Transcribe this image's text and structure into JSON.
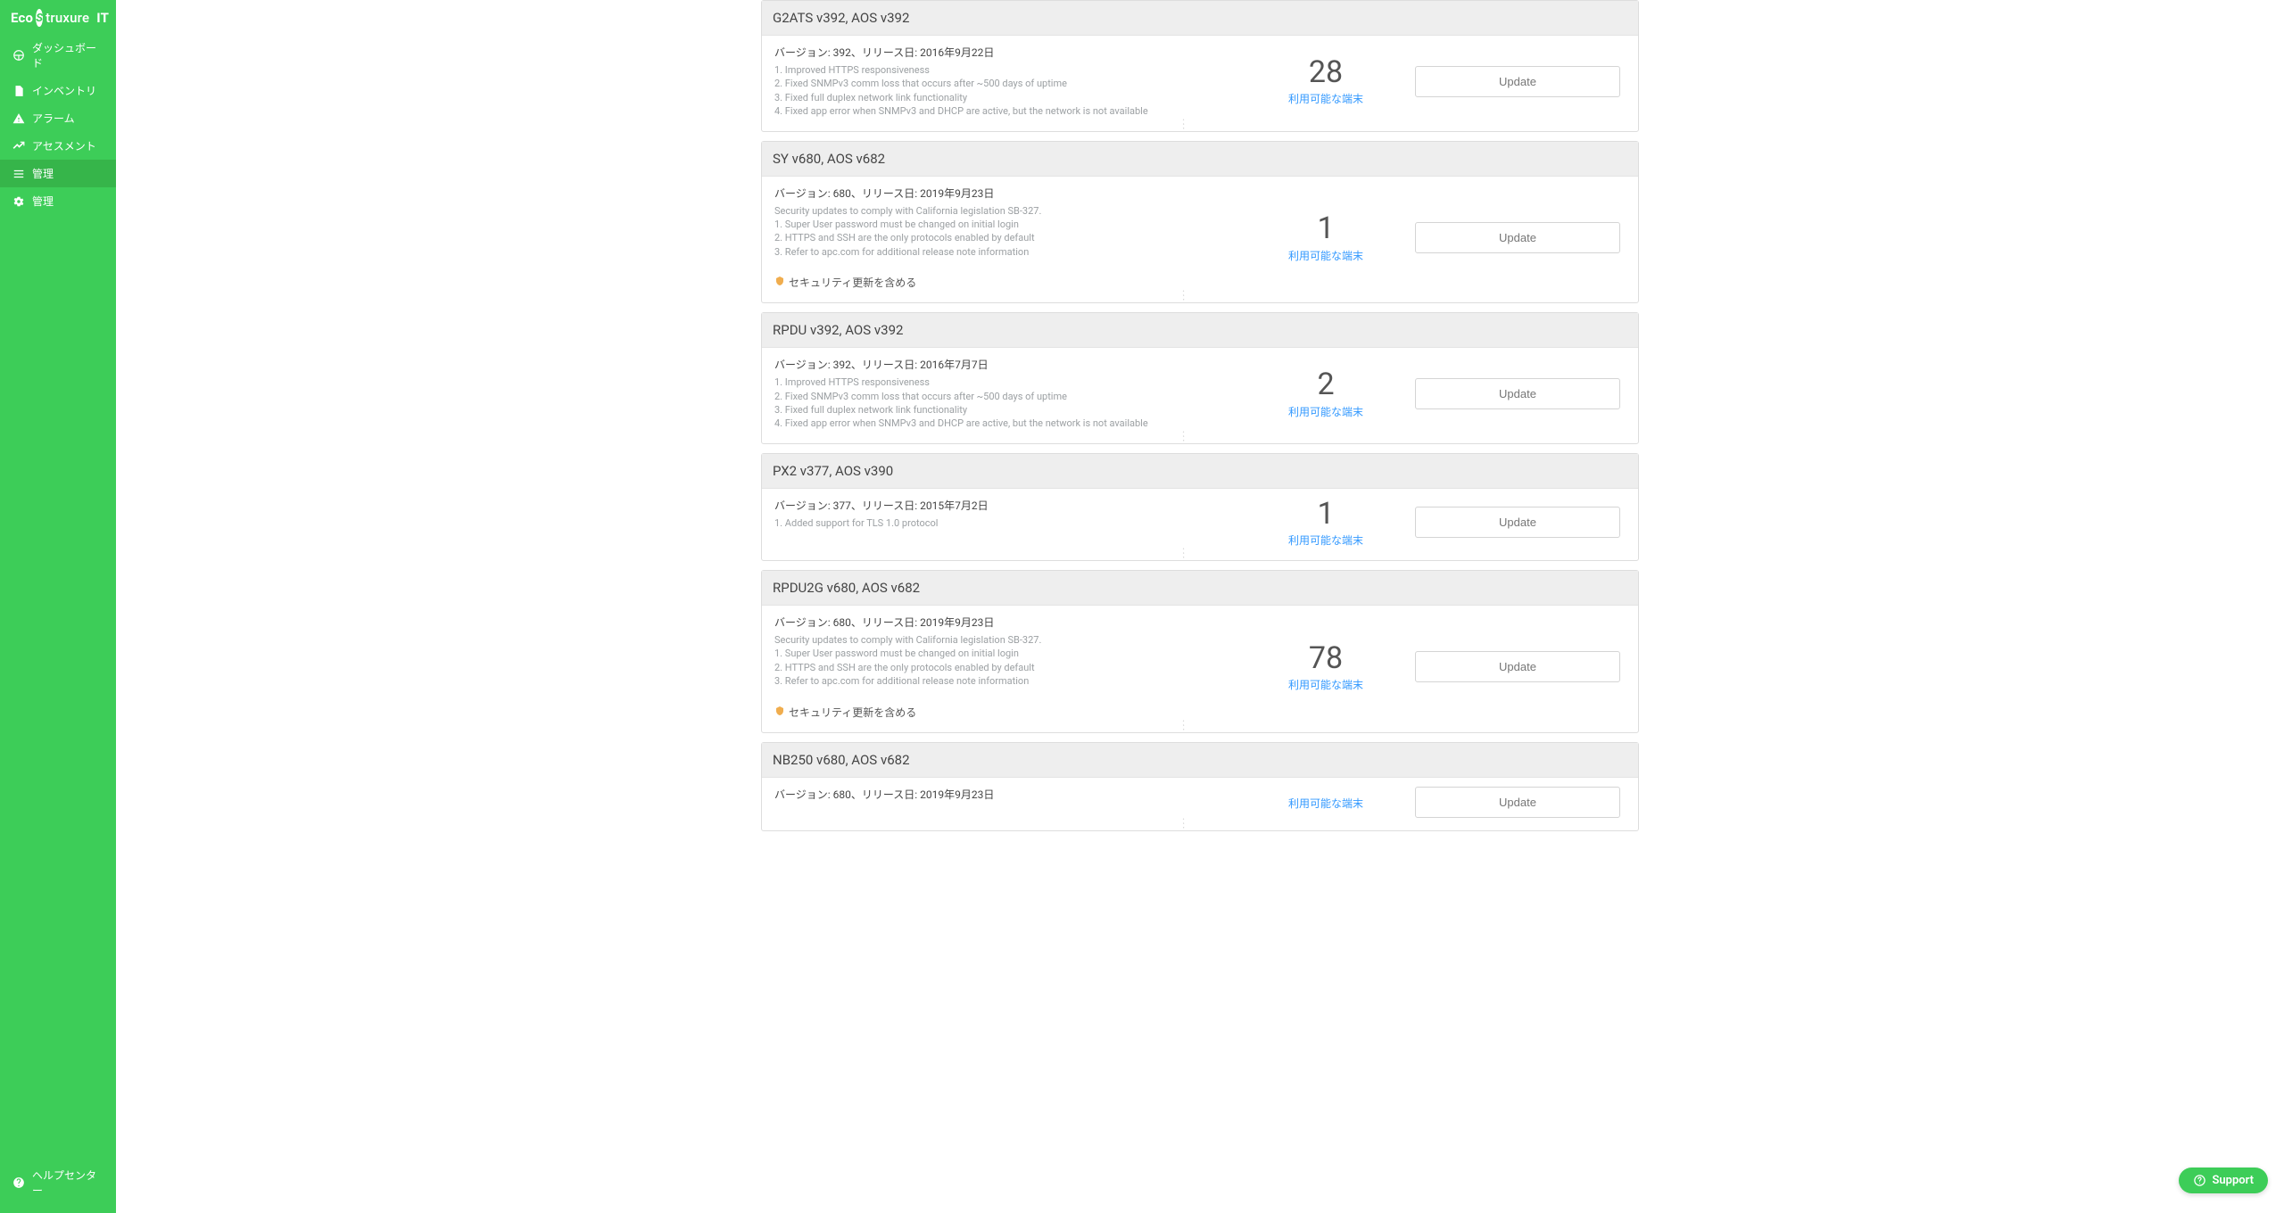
{
  "brand": {
    "part1": "Eco",
    "part2": "truxure",
    "part3": "IT"
  },
  "sidebar": {
    "items": [
      {
        "label": "ダッシュボード"
      },
      {
        "label": "インベントリ"
      },
      {
        "label": "アラーム"
      },
      {
        "label": "アセスメント"
      },
      {
        "label": "管理"
      },
      {
        "label": "管理"
      }
    ],
    "help_label": "ヘルプセンター"
  },
  "common": {
    "available_label": "利用可能な端末",
    "update_label": "Update",
    "security_label": "セキュリティ更新を含める"
  },
  "cards": [
    {
      "title": "G2ATS v392, AOS v392",
      "version_line": "バージョン: 392、リリース日: 2016年9月22日",
      "notes": "1. Improved HTTPS responsiveness\n2. Fixed SNMPv3 comm loss that occurs after ~500 days of uptime\n3. Fixed full duplex network link functionality\n4. Fixed app error when SNMPv3 and DHCP are active, but the network is not available",
      "count": "28",
      "security": false
    },
    {
      "title": "SY v680, AOS v682",
      "version_line": "バージョン: 680、リリース日: 2019年9月23日",
      "notes": "Security updates to comply with California legislation SB-327.\n1. Super User password must be changed on initial login\n2. HTTPS and SSH are the only protocols enabled by default\n3. Refer to apc.com for additional release note information",
      "count": "1",
      "security": true
    },
    {
      "title": "RPDU v392, AOS v392",
      "version_line": "バージョン: 392、リリース日: 2016年7月7日",
      "notes": "1. Improved HTTPS responsiveness\n2. Fixed SNMPv3 comm loss that occurs after ~500 days of uptime\n3. Fixed full duplex network link functionality\n4. Fixed app error when SNMPv3 and DHCP are active, but the network is not available",
      "count": "2",
      "security": false
    },
    {
      "title": "PX2 v377, AOS v390",
      "version_line": "バージョン: 377、リリース日: 2015年7月2日",
      "notes": "1. Added support for TLS 1.0 protocol",
      "count": "1",
      "security": false
    },
    {
      "title": "RPDU2G v680, AOS v682",
      "version_line": "バージョン: 680、リリース日: 2019年9月23日",
      "notes": "Security updates to comply with California legislation SB-327.\n1. Super User password must be changed on initial login\n2. HTTPS and SSH are the only protocols enabled by default\n3. Refer to apc.com for additional release note information",
      "count": "78",
      "security": true
    },
    {
      "title": "NB250 v680, AOS v682",
      "version_line": "バージョン: 680、リリース日: 2019年9月23日",
      "notes": "",
      "count": "",
      "security": false
    }
  ],
  "support": {
    "label": "Support"
  }
}
